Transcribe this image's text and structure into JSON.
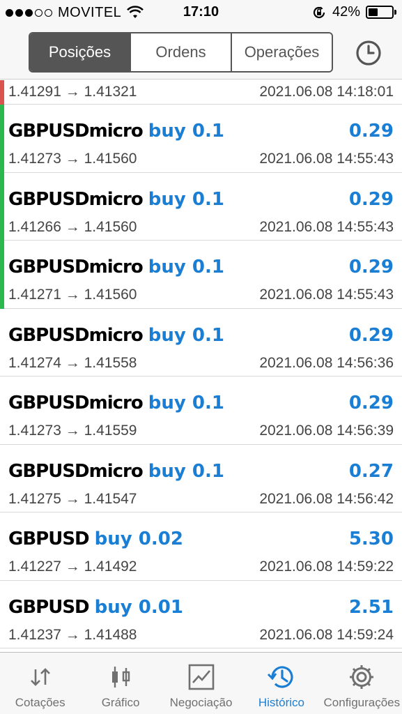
{
  "status_bar": {
    "carrier": "MOVITEL",
    "time": "17:10",
    "battery": "42%",
    "battery_level": 0.42,
    "signal_bars_filled": 3,
    "signal_bars_total": 5
  },
  "tabs_top": [
    {
      "label": "Posições",
      "active": true
    },
    {
      "label": "Ordens",
      "active": false
    },
    {
      "label": "Operações",
      "active": false
    }
  ],
  "colors": {
    "accent": "#1a7fd4",
    "loss_bar": "#d9534f",
    "profit_bar": "#2db84d"
  },
  "trades": [
    {
      "symbol": "",
      "side": "",
      "profit": "",
      "prices": "1.41291 → 1.41321",
      "time": "2021.06.08 14:18:01",
      "bar": "loss"
    },
    {
      "symbol": "GBPUSDmicro",
      "side": "buy 0.1",
      "profit": "0.29",
      "prices": "1.41273 → 1.41560",
      "time": "2021.06.08 14:55:43",
      "bar": "profit"
    },
    {
      "symbol": "GBPUSDmicro",
      "side": "buy 0.1",
      "profit": "0.29",
      "prices": "1.41266 → 1.41560",
      "time": "2021.06.08 14:55:43",
      "bar": "profit"
    },
    {
      "symbol": "GBPUSDmicro",
      "side": "buy 0.1",
      "profit": "0.29",
      "prices": "1.41271 → 1.41560",
      "time": "2021.06.08 14:55:43",
      "bar": "profit"
    },
    {
      "symbol": "GBPUSDmicro",
      "side": "buy 0.1",
      "profit": "0.29",
      "prices": "1.41274 → 1.41558",
      "time": "2021.06.08 14:56:36",
      "bar": "none"
    },
    {
      "symbol": "GBPUSDmicro",
      "side": "buy 0.1",
      "profit": "0.29",
      "prices": "1.41273 → 1.41559",
      "time": "2021.06.08 14:56:39",
      "bar": "none"
    },
    {
      "symbol": "GBPUSDmicro",
      "side": "buy 0.1",
      "profit": "0.27",
      "prices": "1.41275 → 1.41547",
      "time": "2021.06.08 14:56:42",
      "bar": "none"
    },
    {
      "symbol": "GBPUSD",
      "side": "buy 0.02",
      "profit": "5.30",
      "prices": "1.41227 → 1.41492",
      "time": "2021.06.08 14:59:22",
      "bar": "none"
    },
    {
      "symbol": "GBPUSD",
      "side": "buy 0.01",
      "profit": "2.51",
      "prices": "1.41237 → 1.41488",
      "time": "2021.06.08 14:59:24",
      "bar": "none"
    }
  ],
  "tab_bar": [
    {
      "label": "Cotações",
      "icon": "quotes-arrows-icon",
      "active": false
    },
    {
      "label": "Gráfico",
      "icon": "candlestick-chart-icon",
      "active": false
    },
    {
      "label": "Negociação",
      "icon": "trade-chart-icon",
      "active": false
    },
    {
      "label": "Histórico",
      "icon": "history-clock-icon",
      "active": true
    },
    {
      "label": "Configurações",
      "icon": "gear-icon",
      "active": false
    }
  ]
}
